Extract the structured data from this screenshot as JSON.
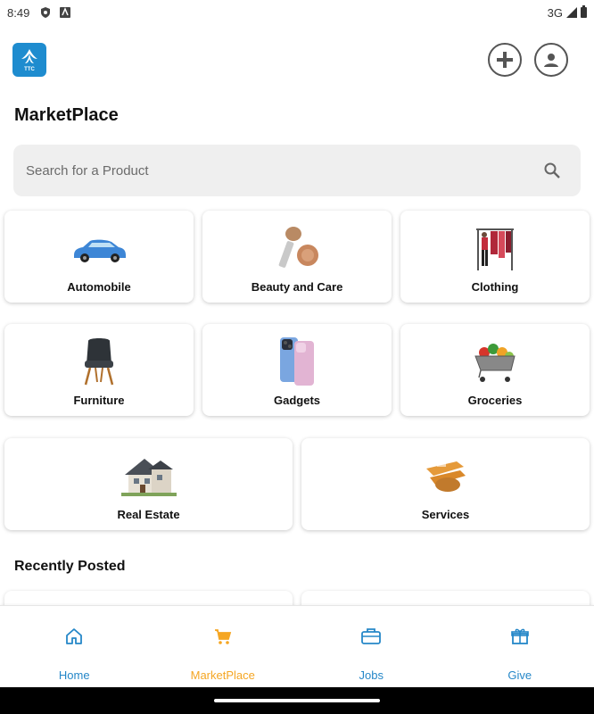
{
  "status_bar": {
    "time": "8:49",
    "network": "3G"
  },
  "header": {
    "logo_text": "TTC"
  },
  "page": {
    "title": "MarketPlace"
  },
  "search": {
    "placeholder": "Search for a Product"
  },
  "categories": [
    {
      "label": "Automobile",
      "icon": "car-icon"
    },
    {
      "label": "Beauty and Care",
      "icon": "makeup-brush-icon"
    },
    {
      "label": "Clothing",
      "icon": "clothing-rack-icon"
    },
    {
      "label": "Furniture",
      "icon": "chair-icon"
    },
    {
      "label": "Gadgets",
      "icon": "phone-icon"
    },
    {
      "label": "Groceries",
      "icon": "grocery-cart-icon"
    },
    {
      "label": "Real Estate",
      "icon": "house-icon"
    },
    {
      "label": "Services",
      "icon": "tools-icon"
    }
  ],
  "recent": {
    "title": "Recently Posted"
  },
  "bottom_nav": [
    {
      "label": "Home",
      "icon": "home-icon",
      "active": false
    },
    {
      "label": "MarketPlace",
      "icon": "cart-icon",
      "active": true
    },
    {
      "label": "Jobs",
      "icon": "briefcase-icon",
      "active": false
    },
    {
      "label": "Give",
      "icon": "gift-icon",
      "active": false
    }
  ],
  "colors": {
    "accent": "#f5a623",
    "nav_blue": "#2587c8",
    "logo_bg": "#1e8ccf"
  }
}
